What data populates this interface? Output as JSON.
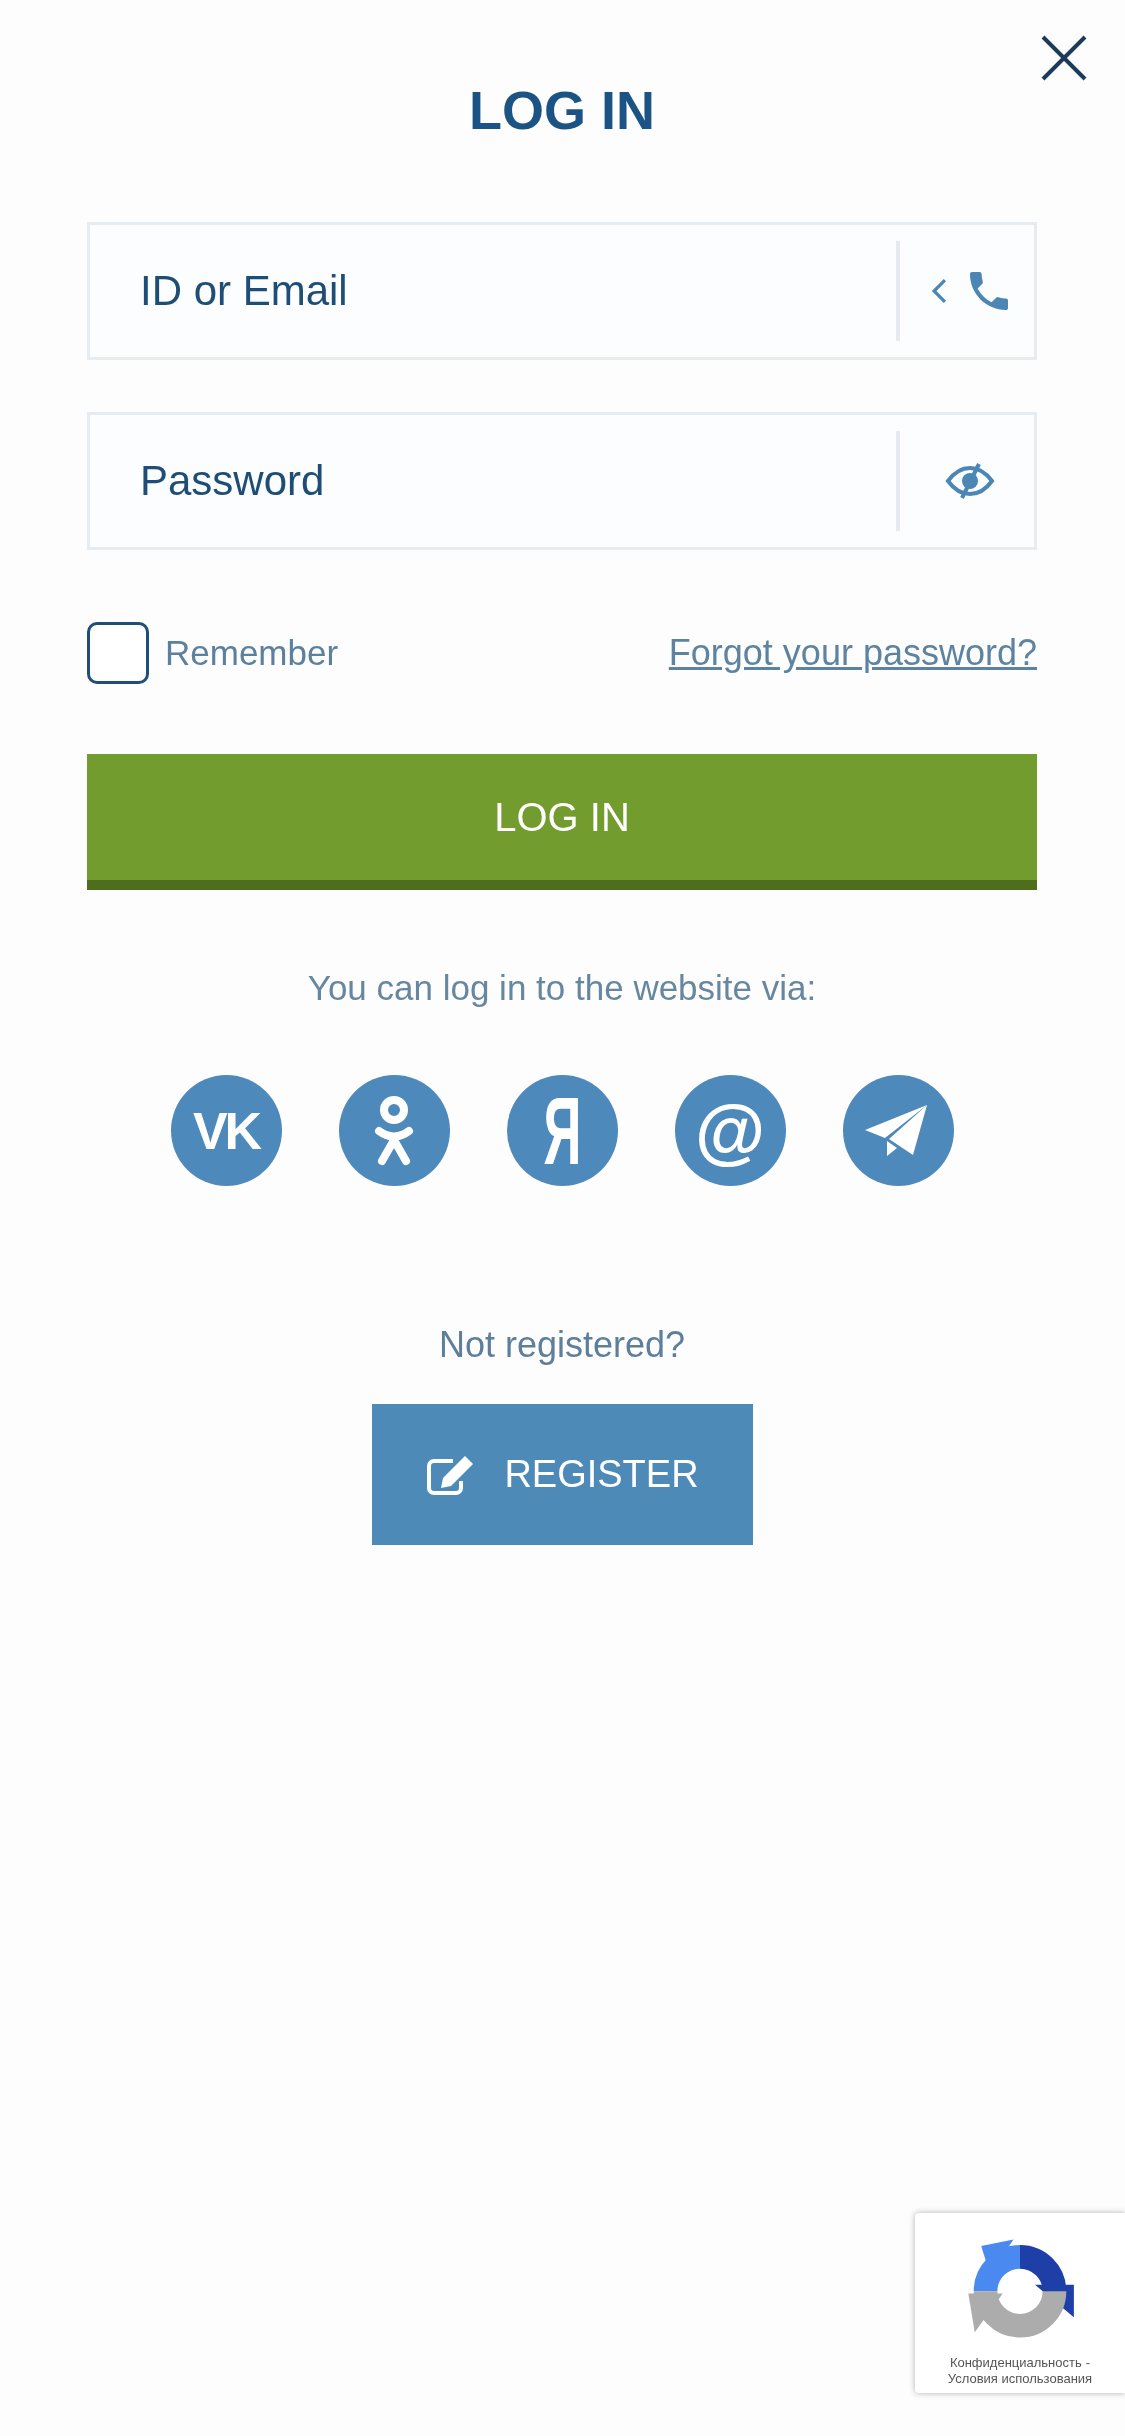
{
  "title": "LOG IN",
  "fields": [
    {
      "kind": "login",
      "placeholder": "ID or Email"
    },
    {
      "kind": "password",
      "placeholder": "Password"
    }
  ],
  "remember": {
    "label": "Remember",
    "checked": false
  },
  "forgot_password_link": "Forgot your password?",
  "login_button": "LOG IN",
  "social_login": {
    "caption": "You can log in to the website via:",
    "providers": [
      {
        "kind": "glyph",
        "glyph": "VK"
      },
      {
        "kind": "figure"
      },
      {
        "kind": "glyph",
        "glyph": "Я"
      },
      {
        "kind": "glyph",
        "glyph": "@"
      },
      {
        "kind": "plane"
      }
    ]
  },
  "registration": {
    "prompt": "Not registered?",
    "button": "REGISTER"
  },
  "recaptcha": {
    "privacy_link": "Конфиденциальность",
    "separator": "-",
    "terms_link": "Условия использования"
  }
}
